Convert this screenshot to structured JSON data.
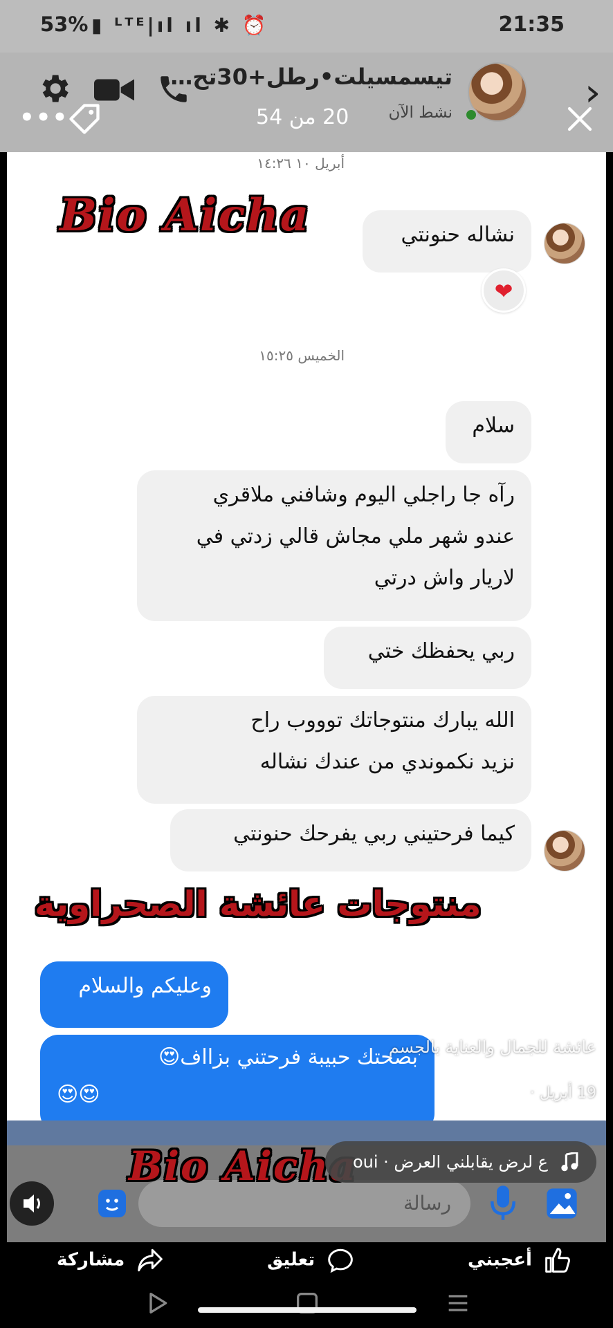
{
  "status_bar": {
    "battery": "53%",
    "network": "4G",
    "time": "21:35"
  },
  "header": {
    "title": "تيسمسيلت•رطل+30تح…",
    "active_status": "نشط الآن",
    "photo_counter": "20 من 54"
  },
  "messages": {
    "ts1": "أبريل ١٠ ١٤:٢٦",
    "m1": "نشاله حنونتي",
    "ts2": "الخميس ١٥:٢٥",
    "m2": "سلام",
    "m3_l1": "رآه جا راجلي اليوم وشافني ملاقري",
    "m3_l2": "عندو شهر ملي مجاش قالي زدتي في",
    "m3_l3": "لاريار واش درتي",
    "m4": "ربي يحفظك ختي",
    "m5_l1": "الله يبارك منتوجاتك توووب راح",
    "m5_l2": "نزيد نكموندي من عندك نشاله",
    "m6": "كيما فرحتيني ربي يفرحك حنونتي",
    "s1": "وعليكم والسلام",
    "s2_l1": "بصحتك حبيبة فرحتني بزااف😍",
    "s2_l2": "😍😍"
  },
  "watermarks": {
    "top": "Bio Aicha",
    "middle": "منتوجات عائشة الصحراوية",
    "bottom": "Bio Aicha"
  },
  "reel": {
    "caption": "عائشة للجمال والعناية بالجسم",
    "date": "19 أبريل ·",
    "music": "ع لرض يقابلني العرض · oui"
  },
  "composer": {
    "placeholder": "رسالة"
  },
  "actions": {
    "like": "أعجبني",
    "comment": "تعليق",
    "share": "مشاركة"
  },
  "colors": {
    "sent_bubble": "#1f7cf0",
    "received_bubble": "#f0f0f0",
    "watermark_red": "#b5161b",
    "heart": "#e0202e"
  }
}
